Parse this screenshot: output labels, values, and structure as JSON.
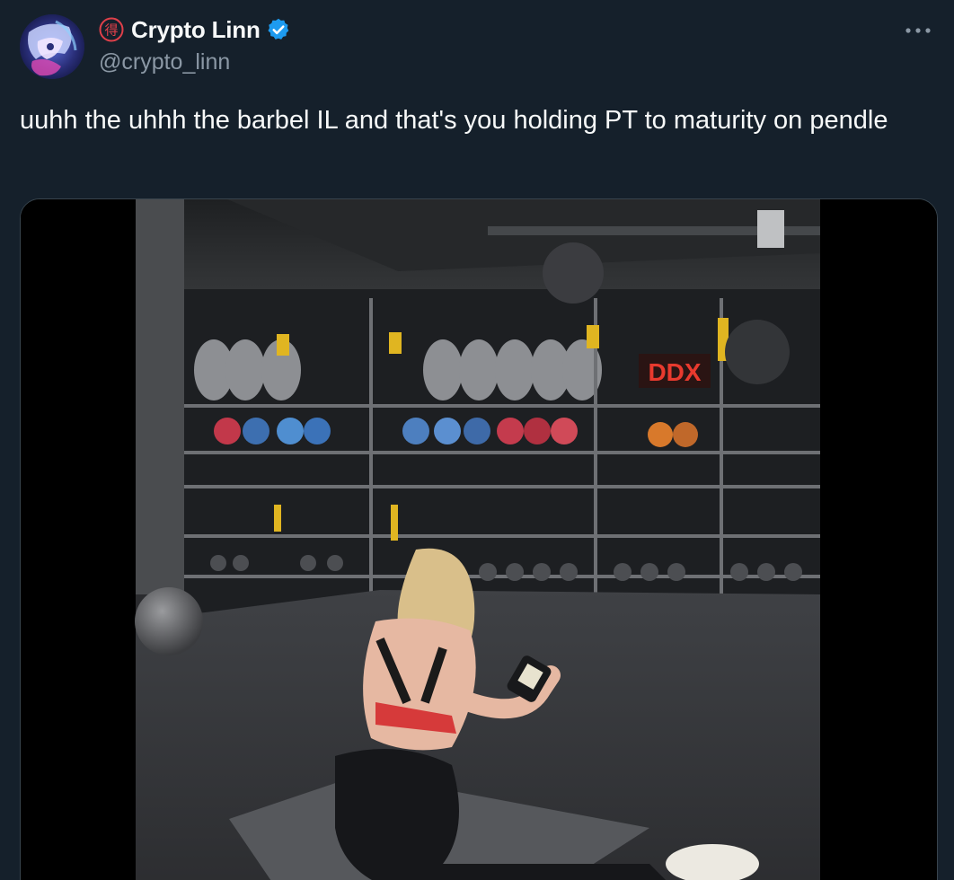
{
  "tweet": {
    "display_name": "Crypto Linn",
    "handle": "@crypto_linn",
    "text": "uuhh the uhhh the barbel IL and that's you holding PT to maturity on pendle",
    "seal_char": "得",
    "gym_sign": "DDX"
  },
  "icons": {
    "seal": "seal-stamp-icon",
    "verified": "verified-badge-icon",
    "more": "more-options-icon"
  },
  "colors": {
    "background": "#15202b",
    "text_primary": "#f7f9f9",
    "text_secondary": "#8b98a5",
    "verified_blue": "#1d9bf0",
    "seal_red": "#e0404a"
  }
}
